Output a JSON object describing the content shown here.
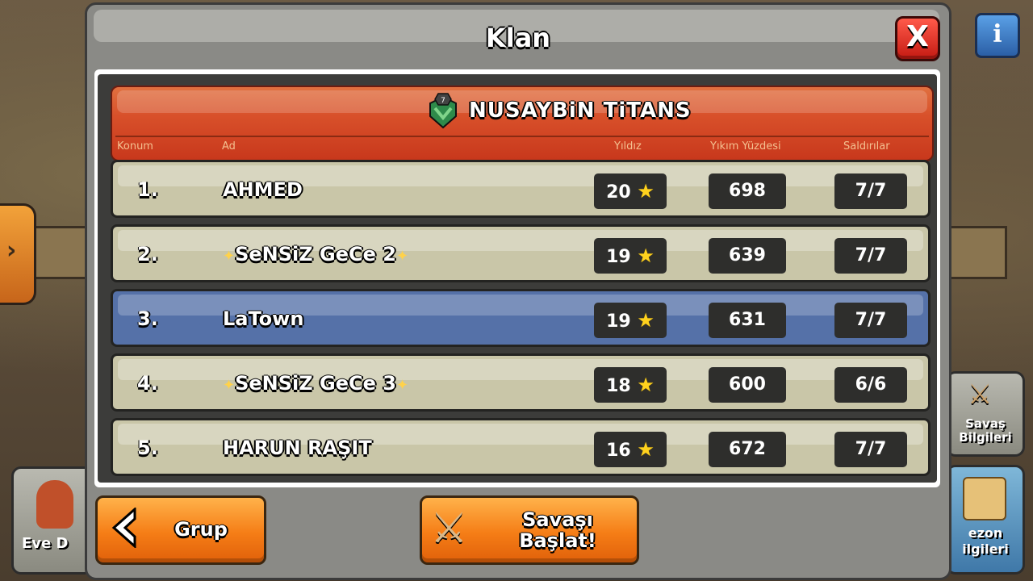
{
  "window": {
    "title": "Klan",
    "close_label": "X",
    "info_label": "i"
  },
  "side_left": {
    "arrow_label": "›",
    "card_label": "Eve D"
  },
  "side_right": {
    "war_info_label": "Savaş Bilgileri",
    "season_info_label": "ezon ilgileri"
  },
  "clan": {
    "name": "NUSAYBiN TiTANS",
    "level": "7"
  },
  "columns": {
    "position": "Konum",
    "name": "Ad",
    "stars": "Yıldız",
    "destruction": "Yıkım Yüzdesi",
    "attacks": "Saldırılar"
  },
  "rows": [
    {
      "pos": "1.",
      "name": "AHMED",
      "stars": "20",
      "destruction": "698",
      "attacks": "7/7",
      "highlighted": false,
      "sparkle": false
    },
    {
      "pos": "2.",
      "name": "SeNSiZ GeCe 2",
      "stars": "19",
      "destruction": "639",
      "attacks": "7/7",
      "highlighted": false,
      "sparkle": true
    },
    {
      "pos": "3.",
      "name": "LaTown",
      "stars": "19",
      "destruction": "631",
      "attacks": "7/7",
      "highlighted": true,
      "sparkle": false
    },
    {
      "pos": "4.",
      "name": "SeNSiZ GeCe 3",
      "stars": "18",
      "destruction": "600",
      "attacks": "6/6",
      "highlighted": false,
      "sparkle": true
    },
    {
      "pos": "5.",
      "name": "HARUN RAŞIT",
      "stars": "16",
      "destruction": "672",
      "attacks": "7/7",
      "highlighted": false,
      "sparkle": false
    }
  ],
  "buttons": {
    "group_label": "Grup",
    "start_war_line1": "Savaşı",
    "start_war_line2": "Başlat!"
  },
  "colors": {
    "header_red": "#d8502a",
    "row_tan": "#c9c6a8",
    "row_highlight_blue": "#5571a8",
    "button_orange": "#f57d16",
    "star_gold": "#ffd21e"
  }
}
